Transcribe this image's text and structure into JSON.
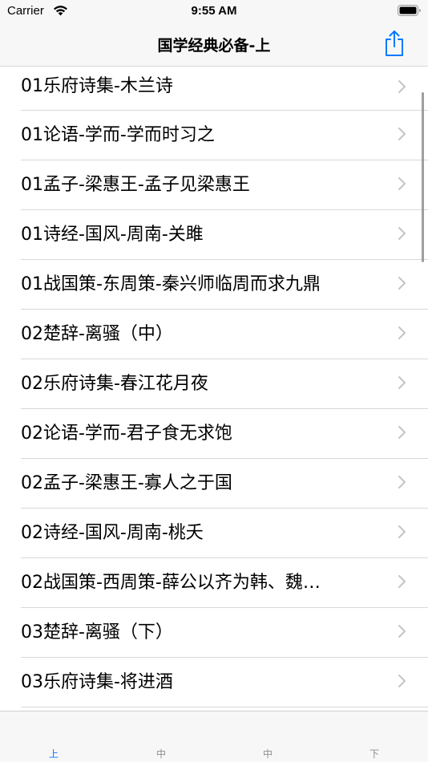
{
  "status": {
    "carrier": "Carrier",
    "time": "9:55 AM"
  },
  "nav": {
    "title": "国学经典必备-上"
  },
  "list": {
    "items": [
      {
        "label": "01乐府诗集-木兰诗"
      },
      {
        "label": "01论语-学而-学而时习之"
      },
      {
        "label": "01孟子-梁惠王-孟子见梁惠王"
      },
      {
        "label": "01诗经-国风-周南-关雎"
      },
      {
        "label": "01战国策-东周策-秦兴师临周而求九鼎"
      },
      {
        "label": "02楚辞-离骚（中）"
      },
      {
        "label": "02乐府诗集-春江花月夜"
      },
      {
        "label": "02论语-学而-君子食无求饱"
      },
      {
        "label": "02孟子-梁惠王-寡人之于国"
      },
      {
        "label": "02诗经-国风-周南-桃夭"
      },
      {
        "label": "02战国策-西周策-薛公以齐为韩、魏…"
      },
      {
        "label": "03楚辞-离骚（下）"
      },
      {
        "label": "03乐府诗集-将进酒"
      }
    ]
  },
  "tabs": [
    {
      "label": "上",
      "active": true
    },
    {
      "label": "中",
      "active": false
    },
    {
      "label": "中",
      "active": false
    },
    {
      "label": "下",
      "active": false
    }
  ],
  "colors": {
    "accent": "#007aff",
    "chevron": "#c4c4c7",
    "separator": "#d8d8d8"
  }
}
